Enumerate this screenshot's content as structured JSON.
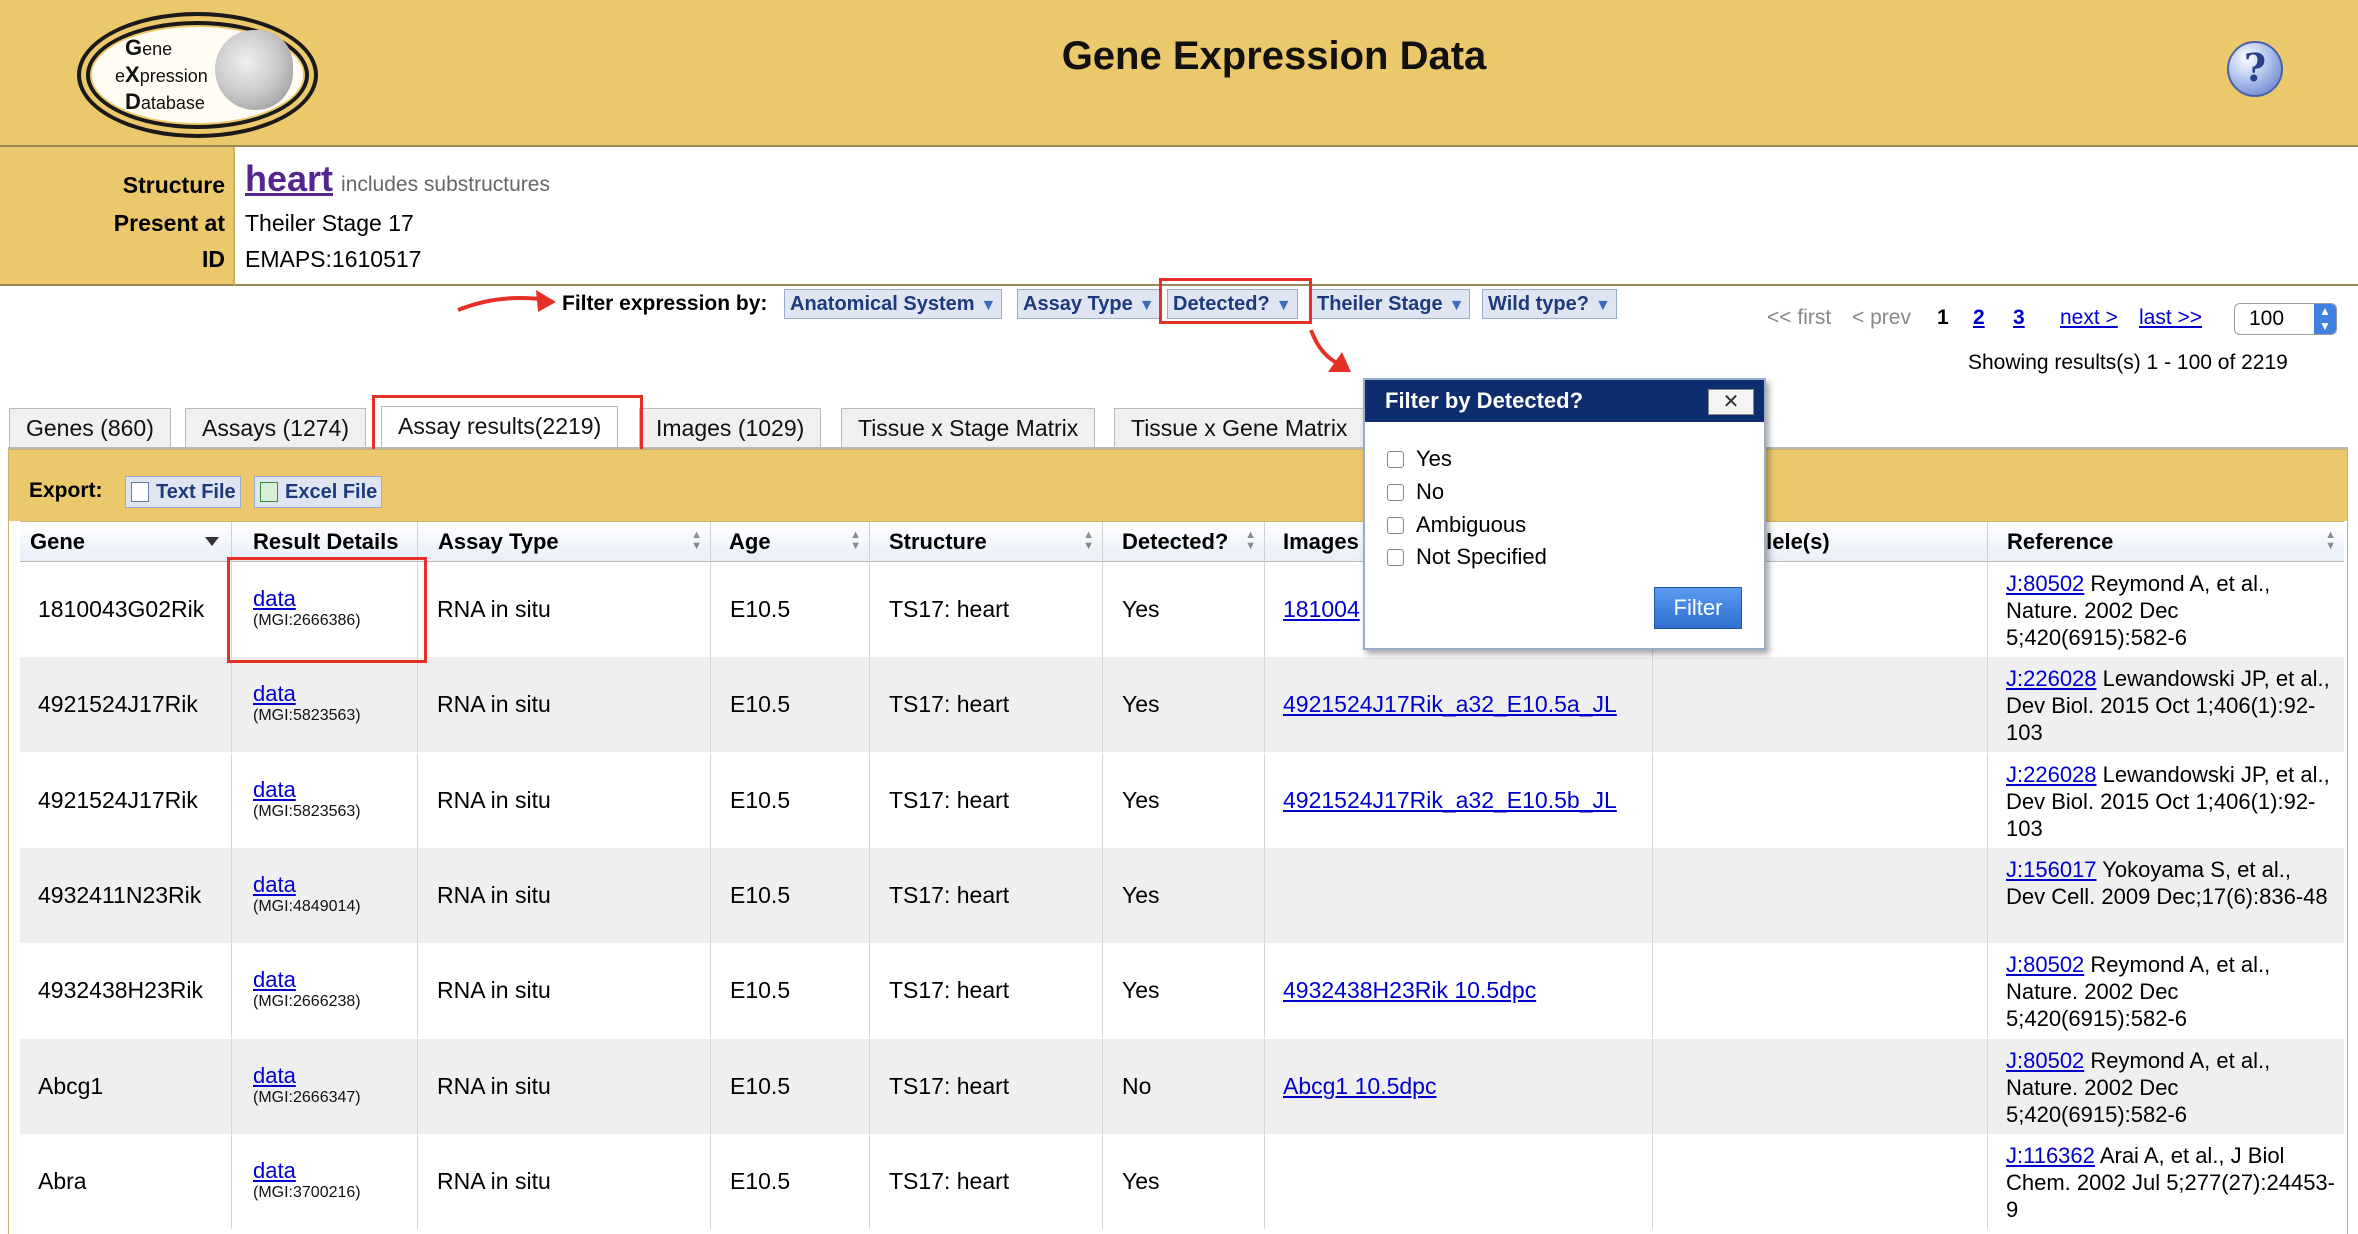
{
  "header": {
    "title": "Gene Expression Data",
    "logo_lines": [
      {
        "initial": "G",
        "rest": "ene"
      },
      {
        "initial": "",
        "rest": "e"
      },
      {
        "initial": "X",
        "rest": "pression"
      },
      {
        "initial": "D",
        "rest": "atabase"
      }
    ],
    "help": "?"
  },
  "summary": {
    "structure_label": "Structure",
    "structure_value": "heart",
    "structure_note": "includes substructures",
    "present_label": "Present at",
    "present_value": "Theiler Stage 17",
    "id_label": "ID",
    "id_value": "EMAPS:1610517"
  },
  "filter": {
    "label": "Filter expression by:",
    "buttons": [
      "Anatomical System",
      "Assay Type",
      "Detected?",
      "Theiler Stage",
      "Wild type?"
    ]
  },
  "pagination": {
    "first": "<< first",
    "prev": "< prev",
    "current": "1",
    "pages": [
      "2",
      "3"
    ],
    "next": "next >",
    "last": "last >>",
    "per_page": "100",
    "results_info": "Showing results(s) 1 - 100 of 2219"
  },
  "tabs": [
    {
      "label": "Genes (860)"
    },
    {
      "label": "Assays (1274)"
    },
    {
      "label": "Assay results(2219)",
      "active": true
    },
    {
      "label": "Images (1029)"
    },
    {
      "label": "Tissue x Stage Matrix"
    },
    {
      "label": "Tissue x Gene Matrix"
    }
  ],
  "export": {
    "label": "Export:",
    "text_file": "Text File",
    "excel_file": "Excel File"
  },
  "table": {
    "headers": [
      "Gene",
      "Result Details",
      "Assay Type",
      "Age",
      "Structure",
      "Detected?",
      "Images",
      "Mutant Allele(s)",
      "Reference"
    ],
    "headers_visible": {
      "allele": "llele(s)"
    },
    "rows": [
      {
        "gene": "1810043G02Rik",
        "detail": "data",
        "mgi": "(MGI:2666386)",
        "assay": "RNA in situ",
        "age": "E10.5",
        "structure": "TS17: heart",
        "detected": "Yes",
        "image": "181004",
        "ref_id": "J:80502",
        "ref_text": "Reymond A, et al., Nature. 2002 Dec 5;420(6915):582-6"
      },
      {
        "gene": "4921524J17Rik",
        "detail": "data",
        "mgi": "(MGI:5823563)",
        "assay": "RNA in situ",
        "age": "E10.5",
        "structure": "TS17: heart",
        "detected": "Yes",
        "image": "4921524J17Rik_a32_E10.5a_JL",
        "ref_id": "J:226028",
        "ref_text": "Lewandowski JP, et al., Dev Biol. 2015 Oct 1;406(1):92-103"
      },
      {
        "gene": "4921524J17Rik",
        "detail": "data",
        "mgi": "(MGI:5823563)",
        "assay": "RNA in situ",
        "age": "E10.5",
        "structure": "TS17: heart",
        "detected": "Yes",
        "image": "4921524J17Rik_a32_E10.5b_JL",
        "ref_id": "J:226028",
        "ref_text": "Lewandowski JP, et al., Dev Biol. 2015 Oct 1;406(1):92-103"
      },
      {
        "gene": "4932411N23Rik",
        "detail": "data",
        "mgi": "(MGI:4849014)",
        "assay": "RNA in situ",
        "age": "E10.5",
        "structure": "TS17: heart",
        "detected": "Yes",
        "image": "",
        "ref_id": "J:156017",
        "ref_text": "Yokoyama S, et al., Dev Cell. 2009 Dec;17(6):836-48"
      },
      {
        "gene": "4932438H23Rik",
        "detail": "data",
        "mgi": "(MGI:2666238)",
        "assay": "RNA in situ",
        "age": "E10.5",
        "structure": "TS17: heart",
        "detected": "Yes",
        "image": "4932438H23Rik 10.5dpc",
        "ref_id": "J:80502",
        "ref_text": "Reymond A, et al., Nature. 2002 Dec 5;420(6915):582-6"
      },
      {
        "gene": "Abcg1",
        "detail": "data",
        "mgi": "(MGI:2666347)",
        "assay": "RNA in situ",
        "age": "E10.5",
        "structure": "TS17: heart",
        "detected": "No",
        "image": "Abcg1 10.5dpc",
        "ref_id": "J:80502",
        "ref_text": "Reymond A, et al., Nature. 2002 Dec 5;420(6915):582-6"
      },
      {
        "gene": "Abra",
        "detail": "data",
        "mgi": "(MGI:3700216)",
        "assay": "RNA in situ",
        "age": "E10.5",
        "structure": "TS17: heart",
        "detected": "Yes",
        "image": "",
        "ref_id": "J:116362",
        "ref_text": "Arai A, et al., J Biol Chem. 2002 Jul 5;277(27):24453-9"
      }
    ]
  },
  "popup": {
    "title": "Filter by Detected?",
    "close": "✕",
    "options": [
      "Yes",
      "No",
      "Ambiguous",
      "Not Specified"
    ],
    "button": "Filter"
  },
  "colors": {
    "header_bg": "#ecc86c",
    "popup_header": "#0d2d6e",
    "highlight": "#e53027",
    "link": "#0000cc",
    "structure_link": "#55278e"
  }
}
